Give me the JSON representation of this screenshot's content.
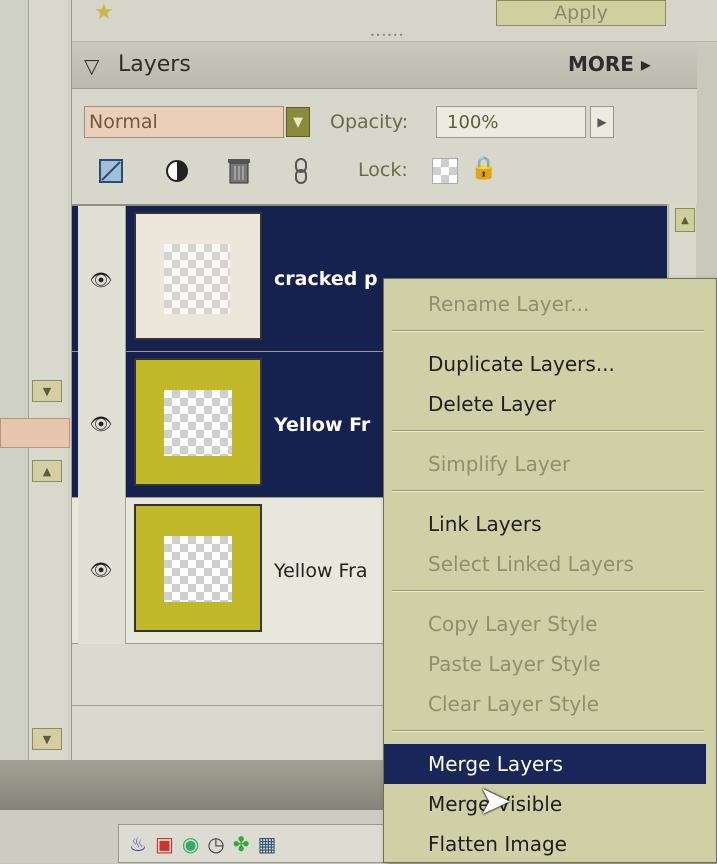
{
  "top": {
    "apply_label": "Apply"
  },
  "panel": {
    "title": "Layers",
    "more_label": "MORE ▸"
  },
  "options": {
    "blend_mode": "Normal",
    "opacity_label": "Opacity:",
    "opacity_value": "100%",
    "lock_label": "Lock:"
  },
  "layers": [
    {
      "name": "cracked p",
      "selected": true
    },
    {
      "name": "Yellow Fr",
      "selected": true
    },
    {
      "name": "Yellow Fra",
      "selected": false
    }
  ],
  "menu": {
    "items": [
      {
        "label": "Rename Layer...",
        "enabled": false
      },
      {
        "label": "Duplicate Layers...",
        "enabled": true
      },
      {
        "label": "Delete Layer",
        "enabled": true
      },
      {
        "label": "Simplify Layer",
        "enabled": false
      },
      {
        "label": "Link Layers",
        "enabled": true
      },
      {
        "label": "Select Linked Layers",
        "enabled": false
      },
      {
        "label": "Copy Layer Style",
        "enabled": false
      },
      {
        "label": "Paste Layer Style",
        "enabled": false
      },
      {
        "label": "Clear Layer Style",
        "enabled": false
      },
      {
        "label": "Merge Layers",
        "enabled": true,
        "highlighted": true
      },
      {
        "label": "Merge Visible",
        "enabled": true
      },
      {
        "label": "Flatten Image",
        "enabled": true
      }
    ]
  },
  "colors": {
    "selection": "#15214f",
    "menu_bg": "#d0d0a6",
    "menu_highlight": "#182659",
    "yellow_frame": "#c1b82a",
    "blend_field": "#eccfbb"
  },
  "icons": [
    "star-icon",
    "new-layer-icon",
    "adjustment-layer-icon",
    "trash-icon",
    "link-icon",
    "lock-transparency-icon",
    "lock-icon",
    "eye-icon",
    "scroll-up-icon",
    "dropdown-arrow-icon",
    "cursor-icon"
  ]
}
